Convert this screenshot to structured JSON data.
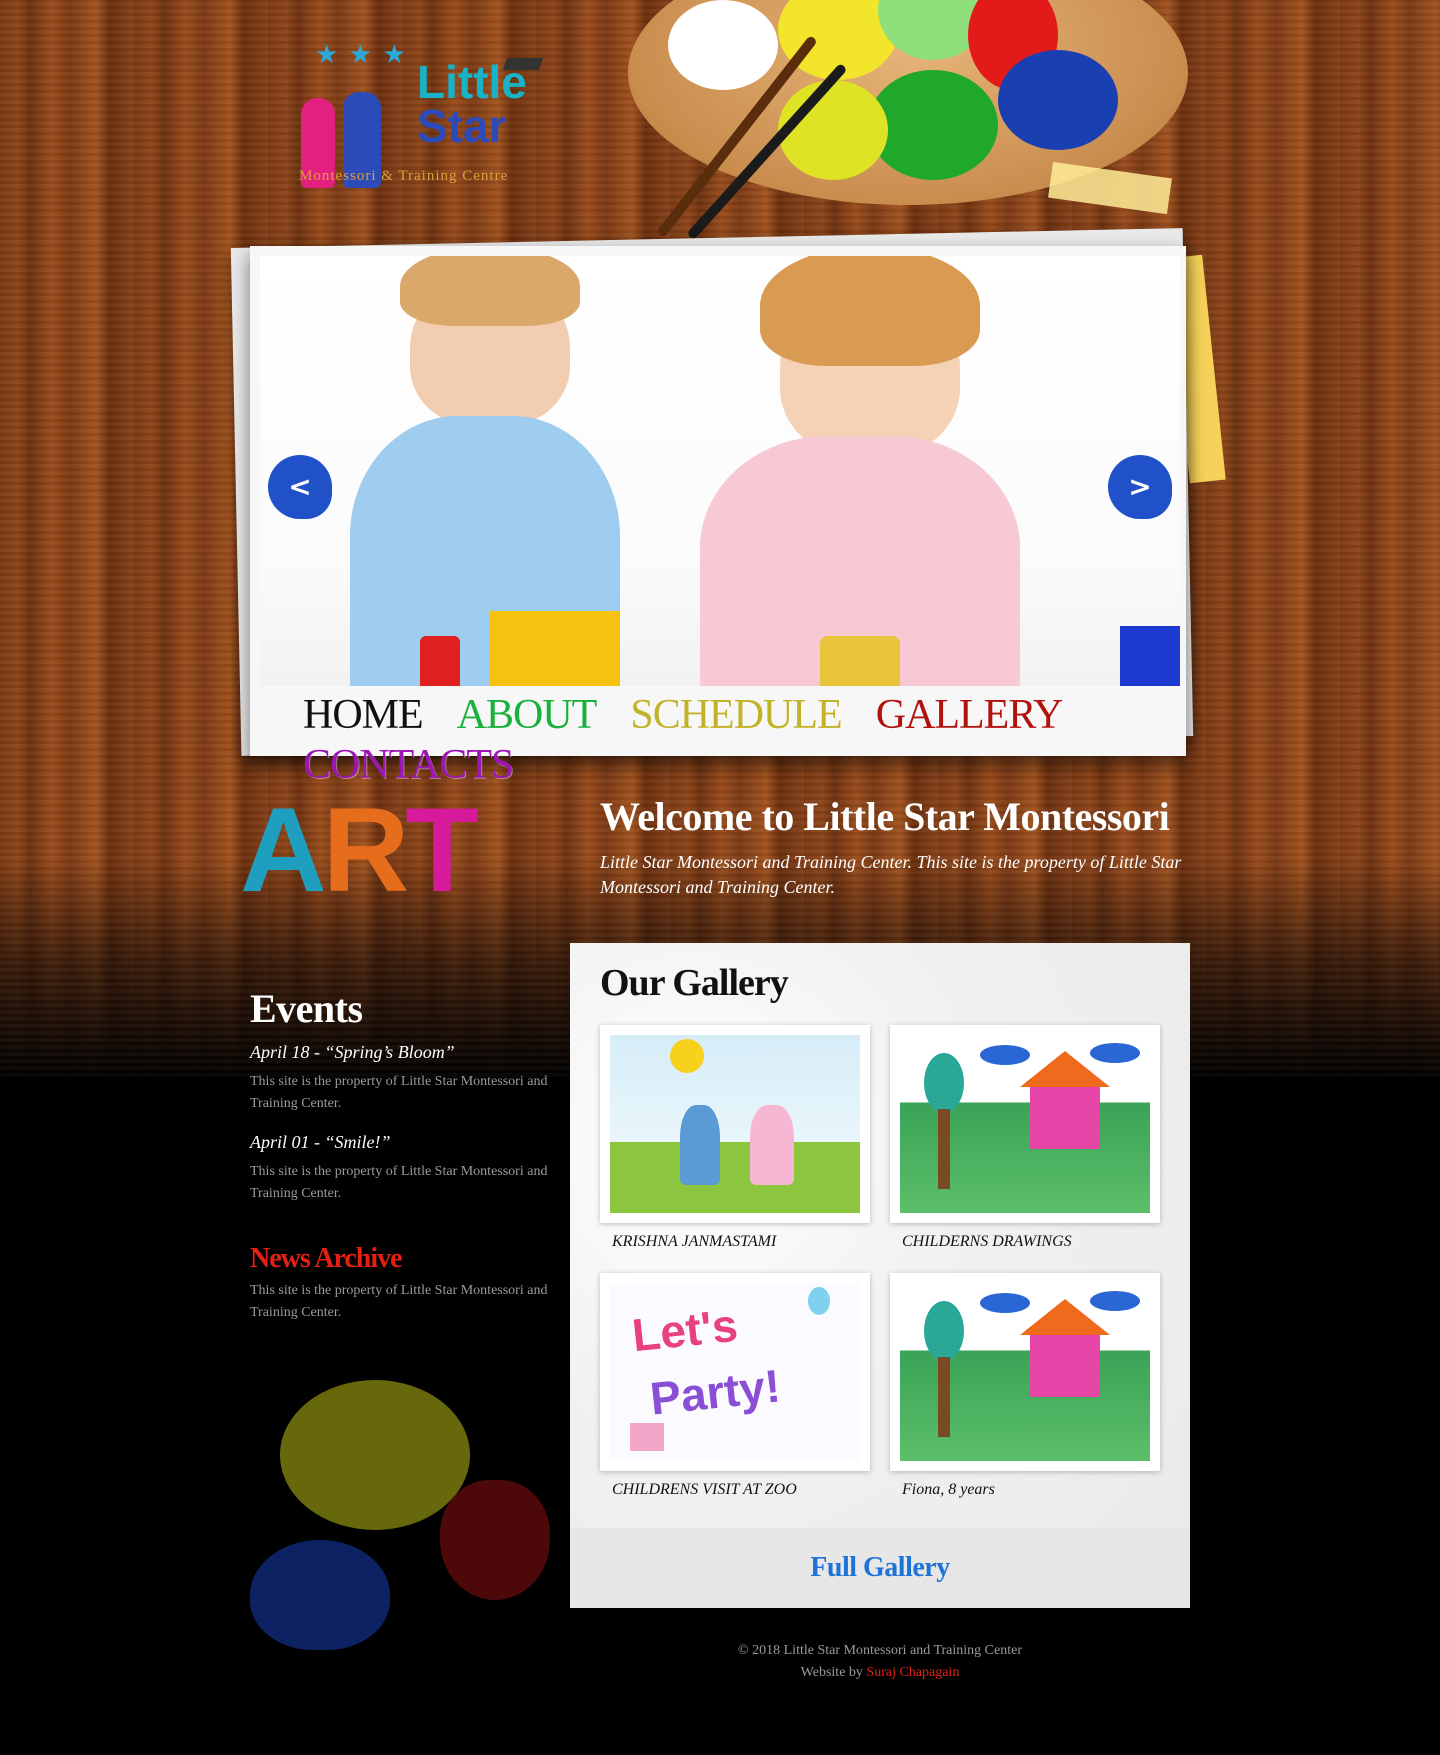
{
  "logo": {
    "name_line1": "Little",
    "name_line2": "Star",
    "subtitle": "Montessori & Training Centre"
  },
  "slider": {
    "prev_label": "<",
    "next_label": ">"
  },
  "nav": {
    "items": [
      {
        "label": "HOME",
        "color": "#111111"
      },
      {
        "label": "ABOUT",
        "color": "#19b13c"
      },
      {
        "label": "SCHEDULE",
        "color": "#c2b22a"
      },
      {
        "label": "GALLERY",
        "color": "#b1120e"
      },
      {
        "label": "CONTACTS",
        "color": "#9c16b5"
      }
    ]
  },
  "art": {
    "letters": [
      "A",
      "R",
      "T"
    ]
  },
  "welcome": {
    "title": "Welcome to Little Star Montessori",
    "text": "Little Star Montessori and Training Center. This site is the property of Little Star Montessori and Training Center."
  },
  "events": {
    "heading": "Events",
    "items": [
      {
        "title": "April 18 - “Spring’s Bloom”",
        "text": "This site is the property of Little Star Montessori and Training Center."
      },
      {
        "title": "April 01 - “Smile!”",
        "text": "This site is the property of Little Star Montessori and Training Center."
      }
    ]
  },
  "news": {
    "heading": "News Archive",
    "text": "This site is the property of Little Star Montessori and Training Center."
  },
  "gallery": {
    "heading": "Our Gallery",
    "items": [
      {
        "caption": "KRISHNA JANMASTAMI"
      },
      {
        "caption": "CHILDERNS DRAWINGS"
      },
      {
        "caption": "CHILDRENS VISIT AT ZOO"
      },
      {
        "caption": "Fiona, 8 years"
      }
    ],
    "party_word1": "Let's",
    "party_word2": "Party!",
    "full_link": "Full Gallery"
  },
  "footer": {
    "copyright": "© 2018 Little Star Montessori and Training Center",
    "credit_prefix": "Website by ",
    "credit_name": "Suraj Chapagain"
  },
  "colors": {
    "accent_link": "#1e73d8",
    "news_red": "#e51f12"
  }
}
